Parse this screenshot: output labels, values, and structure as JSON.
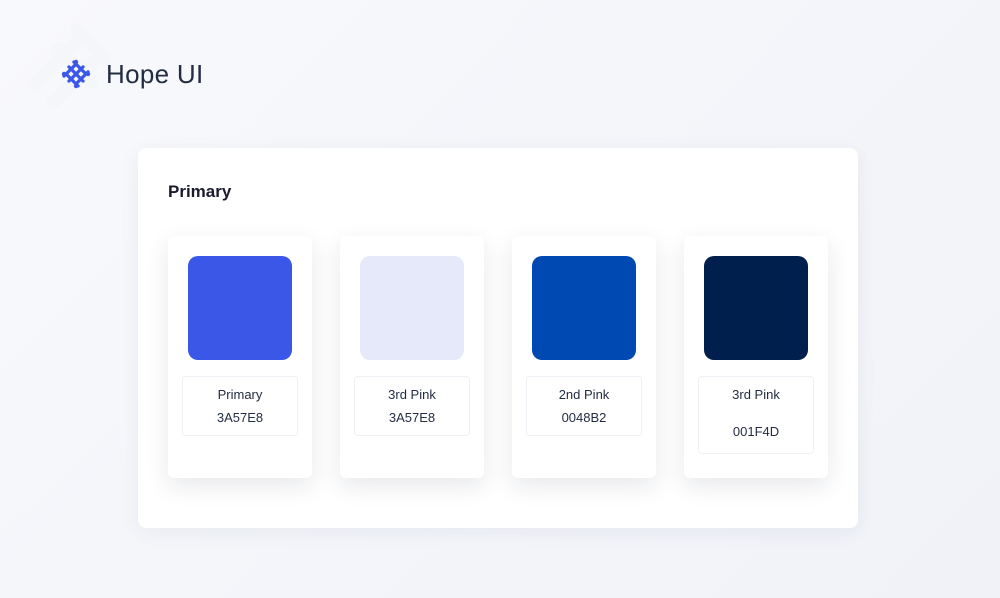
{
  "header": {
    "logo_text": "Hope UI"
  },
  "panel": {
    "title": "Primary",
    "swatches": [
      {
        "color": "#3A57E8",
        "name": "Primary",
        "hex": "3A57E8"
      },
      {
        "color": "#E5E9FA",
        "name": "3rd Pink",
        "hex": "3A57E8"
      },
      {
        "color": "#0048B2",
        "name": "2nd Pink",
        "hex": "0048B2"
      },
      {
        "color": "#001F4D",
        "name": "3rd Pink",
        "hex": "001F4D"
      }
    ]
  }
}
